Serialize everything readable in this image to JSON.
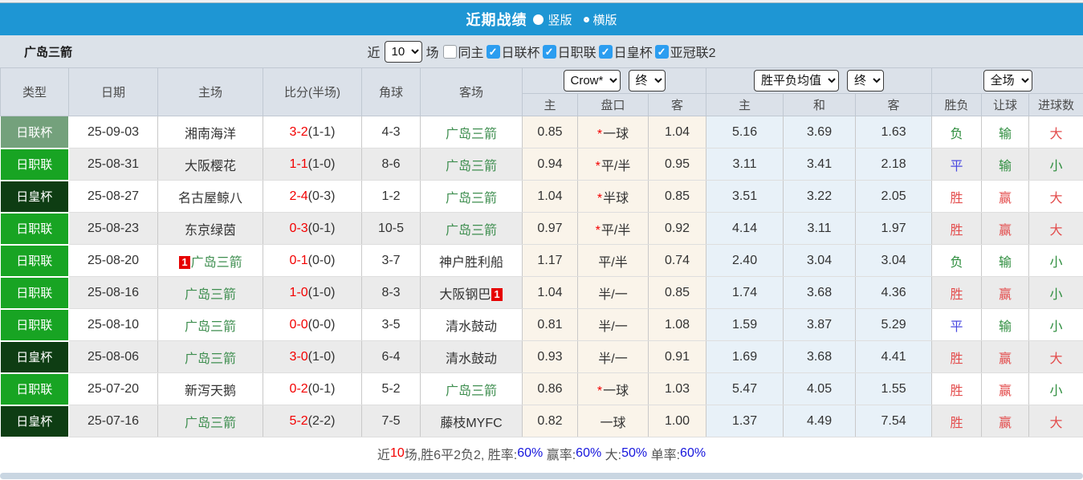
{
  "colors": {
    "topbar_blue": "#1e96d4",
    "bar_gray": "#dce2e9",
    "header_gray": "#dbe1e9",
    "type_league_cup": "#74a17c",
    "type_j1": "#18a423",
    "type_emperor_cup": "#0e3d13",
    "odds_cream": "#faf4ea",
    "avg_blue": "#e8f1f8",
    "team_green": "#3e8e4f",
    "score_red": "#f30000",
    "win_red": "#e34d4d",
    "lose_green": "#2f8e3f",
    "draw_blue": "#4a4ae0",
    "checkbox_blue": "#2b9df0"
  },
  "topbar": {
    "title": "近期战绩",
    "radios": [
      {
        "label": "竖版",
        "selected": true
      },
      {
        "label": "横版",
        "selected": false
      }
    ]
  },
  "filter_bar": {
    "team": "广岛三箭",
    "recent_label": "近",
    "recent_value": "10",
    "matches_label": "场",
    "checkboxes": [
      {
        "label": "同主",
        "checked": false
      },
      {
        "label": "日联杯",
        "checked": true
      },
      {
        "label": "日职联",
        "checked": true
      },
      {
        "label": "日皇杯",
        "checked": true
      },
      {
        "label": "亚冠联2",
        "checked": true
      }
    ]
  },
  "table": {
    "selects": {
      "company": "Crow*",
      "company_time": "终",
      "avg": "胜平负均值",
      "avg_time": "终",
      "scope": "全场"
    },
    "headers": {
      "type": "类型",
      "date": "日期",
      "home": "主场",
      "score": "比分(半场)",
      "corners": "角球",
      "away": "客场",
      "sub": [
        "主",
        "盘口",
        "客",
        "主",
        "和",
        "客",
        "胜负",
        "让球",
        "进球数"
      ]
    },
    "rows": [
      {
        "type": "日联杯",
        "type_key": "lc",
        "date": "25-09-03",
        "home": "湘南海洋",
        "home_green": false,
        "home_badge": "",
        "score": "3-2",
        "half": "(1-1)",
        "corners": "4-3",
        "away": "广岛三箭",
        "away_green": true,
        "away_badge": "",
        "odds_home": "0.85",
        "handicap": "一球",
        "handicap_star": true,
        "odds_away": "1.04",
        "avg_win": "5.16",
        "avg_draw": "3.69",
        "avg_lose": "1.63",
        "result": "负",
        "result_color": "green",
        "handicap_result": "输",
        "handicap_result_color": "green",
        "goals_result": "大",
        "goals_result_color": "red"
      },
      {
        "type": "日职联",
        "type_key": "j1",
        "date": "25-08-31",
        "home": "大阪樱花",
        "home_green": false,
        "home_badge": "",
        "score": "1-1",
        "half": "(1-0)",
        "corners": "8-6",
        "away": "广岛三箭",
        "away_green": true,
        "away_badge": "",
        "odds_home": "0.94",
        "handicap": "平/半",
        "handicap_star": true,
        "odds_away": "0.95",
        "avg_win": "3.11",
        "avg_draw": "3.41",
        "avg_lose": "2.18",
        "result": "平",
        "result_color": "blue",
        "handicap_result": "输",
        "handicap_result_color": "green",
        "goals_result": "小",
        "goals_result_color": "green"
      },
      {
        "type": "日皇杯",
        "type_key": "ec",
        "date": "25-08-27",
        "home": "名古屋鲸八",
        "home_green": false,
        "home_badge": "",
        "score": "2-4",
        "half": "(0-3)",
        "corners": "1-2",
        "away": "广岛三箭",
        "away_green": true,
        "away_badge": "",
        "odds_home": "1.04",
        "handicap": "半球",
        "handicap_star": true,
        "odds_away": "0.85",
        "avg_win": "3.51",
        "avg_draw": "3.22",
        "avg_lose": "2.05",
        "result": "胜",
        "result_color": "red",
        "handicap_result": "赢",
        "handicap_result_color": "red",
        "goals_result": "大",
        "goals_result_color": "red"
      },
      {
        "type": "日职联",
        "type_key": "j1",
        "date": "25-08-23",
        "home": "东京绿茵",
        "home_green": false,
        "home_badge": "",
        "score": "0-3",
        "half": "(0-1)",
        "corners": "10-5",
        "away": "广岛三箭",
        "away_green": true,
        "away_badge": "",
        "odds_home": "0.97",
        "handicap": "平/半",
        "handicap_star": true,
        "odds_away": "0.92",
        "avg_win": "4.14",
        "avg_draw": "3.11",
        "avg_lose": "1.97",
        "result": "胜",
        "result_color": "red",
        "handicap_result": "赢",
        "handicap_result_color": "red",
        "goals_result": "大",
        "goals_result_color": "red"
      },
      {
        "type": "日职联",
        "type_key": "j1",
        "date": "25-08-20",
        "home": "广岛三箭",
        "home_green": true,
        "home_badge": "1",
        "score": "0-1",
        "half": "(0-0)",
        "corners": "3-7",
        "away": "神户胜利船",
        "away_green": false,
        "away_badge": "",
        "odds_home": "1.17",
        "handicap": "平/半",
        "handicap_star": false,
        "odds_away": "0.74",
        "avg_win": "2.40",
        "avg_draw": "3.04",
        "avg_lose": "3.04",
        "result": "负",
        "result_color": "green",
        "handicap_result": "输",
        "handicap_result_color": "green",
        "goals_result": "小",
        "goals_result_color": "green"
      },
      {
        "type": "日职联",
        "type_key": "j1",
        "date": "25-08-16",
        "home": "广岛三箭",
        "home_green": true,
        "home_badge": "",
        "score": "1-0",
        "half": "(1-0)",
        "corners": "8-3",
        "away": "大阪钢巴",
        "away_green": false,
        "away_badge": "1",
        "odds_home": "1.04",
        "handicap": "半/一",
        "handicap_star": false,
        "odds_away": "0.85",
        "avg_win": "1.74",
        "avg_draw": "3.68",
        "avg_lose": "4.36",
        "result": "胜",
        "result_color": "red",
        "handicap_result": "赢",
        "handicap_result_color": "red",
        "goals_result": "小",
        "goals_result_color": "green"
      },
      {
        "type": "日职联",
        "type_key": "j1",
        "date": "25-08-10",
        "home": "广岛三箭",
        "home_green": true,
        "home_badge": "",
        "score": "0-0",
        "half": "(0-0)",
        "corners": "3-5",
        "away": "清水鼓动",
        "away_green": false,
        "away_badge": "",
        "odds_home": "0.81",
        "handicap": "半/一",
        "handicap_star": false,
        "odds_away": "1.08",
        "avg_win": "1.59",
        "avg_draw": "3.87",
        "avg_lose": "5.29",
        "result": "平",
        "result_color": "blue",
        "handicap_result": "输",
        "handicap_result_color": "green",
        "goals_result": "小",
        "goals_result_color": "green"
      },
      {
        "type": "日皇杯",
        "type_key": "ec",
        "date": "25-08-06",
        "home": "广岛三箭",
        "home_green": true,
        "home_badge": "",
        "score": "3-0",
        "half": "(1-0)",
        "corners": "6-4",
        "away": "清水鼓动",
        "away_green": false,
        "away_badge": "",
        "odds_home": "0.93",
        "handicap": "半/一",
        "handicap_star": false,
        "odds_away": "0.91",
        "avg_win": "1.69",
        "avg_draw": "3.68",
        "avg_lose": "4.41",
        "result": "胜",
        "result_color": "red",
        "handicap_result": "赢",
        "handicap_result_color": "red",
        "goals_result": "大",
        "goals_result_color": "red"
      },
      {
        "type": "日职联",
        "type_key": "j1",
        "date": "25-07-20",
        "home": "新泻天鹅",
        "home_green": false,
        "home_badge": "",
        "score": "0-2",
        "half": "(0-1)",
        "corners": "5-2",
        "away": "广岛三箭",
        "away_green": true,
        "away_badge": "",
        "odds_home": "0.86",
        "handicap": "一球",
        "handicap_star": true,
        "odds_away": "1.03",
        "avg_win": "5.47",
        "avg_draw": "4.05",
        "avg_lose": "1.55",
        "result": "胜",
        "result_color": "red",
        "handicap_result": "赢",
        "handicap_result_color": "red",
        "goals_result": "小",
        "goals_result_color": "green"
      },
      {
        "type": "日皇杯",
        "type_key": "ec",
        "date": "25-07-16",
        "home": "广岛三箭",
        "home_green": true,
        "home_badge": "",
        "score": "5-2",
        "half": "(2-2)",
        "corners": "7-5",
        "away": "藤枝MYFC",
        "away_green": false,
        "away_badge": "",
        "odds_home": "0.82",
        "handicap": "一球",
        "handicap_star": false,
        "odds_away": "1.00",
        "avg_win": "1.37",
        "avg_draw": "4.49",
        "avg_lose": "7.54",
        "result": "胜",
        "result_color": "red",
        "handicap_result": "赢",
        "handicap_result_color": "red",
        "goals_result": "大",
        "goals_result_color": "red"
      }
    ]
  },
  "summary": {
    "segments": [
      {
        "text": "近",
        "color": "dim"
      },
      {
        "text": "10",
        "color": "red"
      },
      {
        "text": "场,胜6平2负2, ",
        "color": "dim"
      },
      {
        "text": "胜率:",
        "color": "dim"
      },
      {
        "text": "60%",
        "color": "blue"
      },
      {
        "text": " 赢率:",
        "color": "dim"
      },
      {
        "text": "60%",
        "color": "blue"
      },
      {
        "text": " 大:",
        "color": "dim"
      },
      {
        "text": "50%",
        "color": "blue"
      },
      {
        "text": " 单率:",
        "color": "dim"
      },
      {
        "text": "60%",
        "color": "blue"
      }
    ]
  }
}
